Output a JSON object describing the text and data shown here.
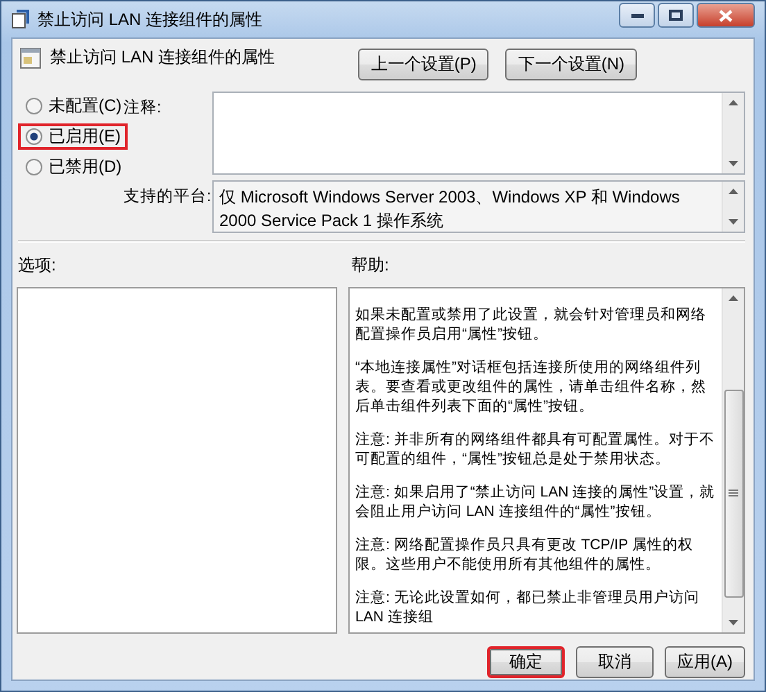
{
  "window": {
    "title": "禁止访问 LAN 连接组件的属性"
  },
  "header": {
    "title": "禁止访问 LAN 连接组件的属性",
    "nav_buttons": [
      {
        "label": "上一个设置(P)"
      },
      {
        "label": "下一个设置(N)"
      }
    ]
  },
  "state_options": [
    {
      "label": "未配置(C)",
      "selected": false,
      "highlighted": false
    },
    {
      "label": "已启用(E)",
      "selected": true,
      "highlighted": true
    },
    {
      "label": "已禁用(D)",
      "selected": false,
      "highlighted": false
    }
  ],
  "comment": {
    "label": "注释:"
  },
  "platform": {
    "label": "支持的平台:",
    "value": "仅 Microsoft Windows Server 2003、Windows XP 和 Windows 2000 Service Pack 1 操作系统"
  },
  "options": {
    "label": "选项:"
  },
  "help": {
    "label": "帮助:",
    "paragraphs": [
      "如果未配置或禁用了此设置，就会针对管理员和网络配置操作员启用“属性”按钮。",
      "“本地连接属性”对话框包括连接所使用的网络组件列表。要查看或更改组件的属性，请单击组件名称，然后单击组件列表下面的“属性”按钮。",
      "注意: 并非所有的网络组件都具有可配置属性。对于不可配置的组件，“属性”按钮总是处于禁用状态。",
      "注意: 如果启用了“禁止访问 LAN 连接的属性”设置，就会阻止用户访问 LAN 连接组件的“属性”按钮。",
      "注意: 网络配置操作员只具有更改 TCP/IP 属性的权限。这些用户不能使用所有其他组件的属性。",
      "注意: 无论此设置如何，都已禁止非管理员用户访问 LAN 连接组"
    ]
  },
  "buttons": [
    {
      "label": "确定",
      "highlighted": true
    },
    {
      "label": "取消",
      "highlighted": false
    },
    {
      "label": "应用(A)",
      "highlighted": false
    }
  ]
}
